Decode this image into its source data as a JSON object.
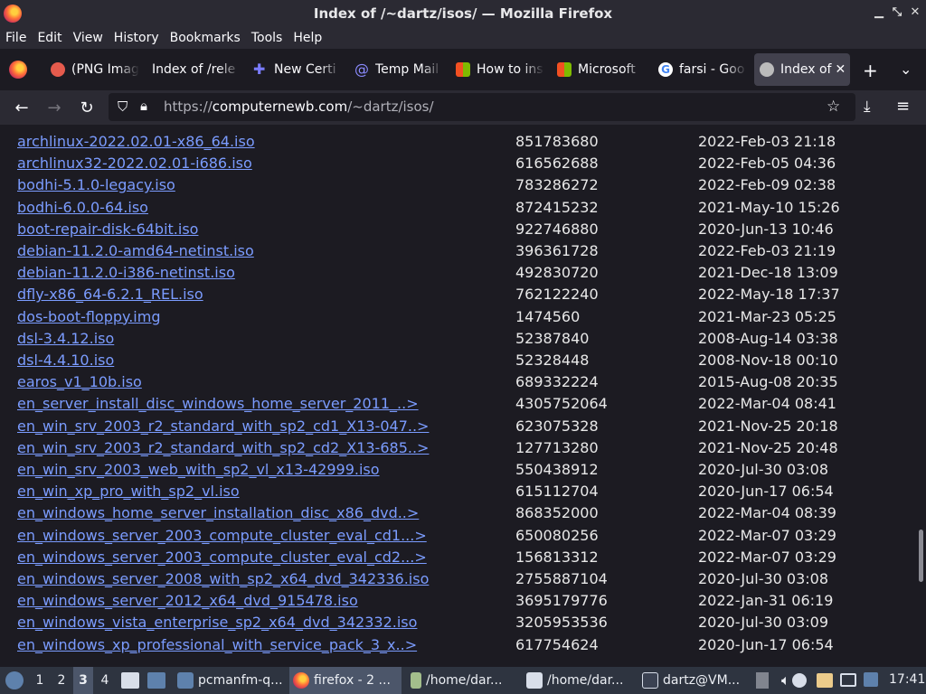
{
  "window": {
    "title": "Index of /~dartz/isos/ — Mozilla Firefox"
  },
  "menu": [
    "File",
    "Edit",
    "View",
    "History",
    "Bookmarks",
    "Tools",
    "Help"
  ],
  "tabs": [
    {
      "label": "(PNG Imag",
      "icon": "camera-icon",
      "color": "#e55b4d"
    },
    {
      "label": "Index of /rele",
      "icon": "none",
      "color": "#1c1b22"
    },
    {
      "label": "New Certi",
      "icon": "puzzle-icon",
      "color": "#7a7cff"
    },
    {
      "label": "Temp Mail",
      "icon": "at-icon",
      "color": "#7b7bff"
    },
    {
      "label": "How to ins",
      "icon": "microsoft-icon",
      "color": "#f25022"
    },
    {
      "label": "Microsoft",
      "icon": "microsoft-icon",
      "color": "#f25022"
    },
    {
      "label": "farsi - Goo",
      "icon": "google-icon",
      "color": "#ffffff"
    },
    {
      "label": "Index of",
      "icon": "gnu-icon",
      "color": "#cccccc"
    }
  ],
  "url": {
    "prefix": "https://",
    "host": "computernewb.com",
    "path": "/~dartz/isos/"
  },
  "files": [
    {
      "name": "archlinux-2022.02.01-x86_64.iso",
      "size": "851783680",
      "date": "2022-Feb-03 21:18"
    },
    {
      "name": "archlinux32-2022.02.01-i686.iso",
      "size": "616562688",
      "date": "2022-Feb-05 04:36"
    },
    {
      "name": "bodhi-5.1.0-legacy.iso",
      "size": "783286272",
      "date": "2022-Feb-09 02:38"
    },
    {
      "name": "bodhi-6.0.0-64.iso",
      "size": "872415232",
      "date": "2021-May-10 15:26"
    },
    {
      "name": "boot-repair-disk-64bit.iso",
      "size": "922746880",
      "date": "2020-Jun-13 10:46"
    },
    {
      "name": "debian-11.2.0-amd64-netinst.iso",
      "size": "396361728",
      "date": "2022-Feb-03 21:19"
    },
    {
      "name": "debian-11.2.0-i386-netinst.iso",
      "size": "492830720",
      "date": "2021-Dec-18 13:09"
    },
    {
      "name": "dfly-x86_64-6.2.1_REL.iso",
      "size": "762122240",
      "date": "2022-May-18 17:37"
    },
    {
      "name": "dos-boot-floppy.img",
      "size": "1474560",
      "date": "2021-Mar-23 05:25"
    },
    {
      "name": "dsl-3.4.12.iso",
      "size": "52387840",
      "date": "2008-Aug-14 03:38"
    },
    {
      "name": "dsl-4.4.10.iso",
      "size": "52328448",
      "date": "2008-Nov-18 00:10"
    },
    {
      "name": "earos_v1_10b.iso",
      "size": "689332224",
      "date": "2015-Aug-08 20:35"
    },
    {
      "name": "en_server_install_disc_windows_home_server_2011_..>",
      "size": "4305752064",
      "date": "2022-Mar-04 08:41"
    },
    {
      "name": "en_win_srv_2003_r2_standard_with_sp2_cd1_X13-047..>",
      "size": "623075328",
      "date": "2021-Nov-25 20:18"
    },
    {
      "name": "en_win_srv_2003_r2_standard_with_sp2_cd2_X13-685..>",
      "size": "127713280",
      "date": "2021-Nov-25 20:48"
    },
    {
      "name": "en_win_srv_2003_web_with_sp2_vl_x13-42999.iso",
      "size": "550438912",
      "date": "2020-Jul-30 03:08"
    },
    {
      "name": "en_win_xp_pro_with_sp2_vl.iso",
      "size": "615112704",
      "date": "2020-Jun-17 06:54"
    },
    {
      "name": "en_windows_home_server_installation_disc_x86_dvd..>",
      "size": "868352000",
      "date": "2022-Mar-04 08:39"
    },
    {
      "name": "en_windows_server_2003_compute_cluster_eval_cd1...>",
      "size": "650080256",
      "date": "2022-Mar-07 03:29"
    },
    {
      "name": "en_windows_server_2003_compute_cluster_eval_cd2...>",
      "size": "156813312",
      "date": "2022-Mar-07 03:29"
    },
    {
      "name": "en_windows_server_2008_with_sp2_x64_dvd_342336.iso",
      "size": "2755887104",
      "date": "2020-Jul-30 03:08"
    },
    {
      "name": "en_windows_server_2012_x64_dvd_915478.iso",
      "size": "3695179776",
      "date": "2022-Jan-31 06:19"
    },
    {
      "name": "en_windows_vista_enterprise_sp2_x64_dvd_342332.iso",
      "size": "3205953536",
      "date": "2020-Jul-30 03:09"
    },
    {
      "name": "en_windows_xp_professional_with_service_pack_3_x..>",
      "size": "617754624",
      "date": "2020-Jun-17 06:54"
    }
  ],
  "taskbar": {
    "workspaces": [
      "1",
      "2",
      "3",
      "4"
    ],
    "active_workspace": "3",
    "tasks": [
      {
        "label": "pcmanfm-q...",
        "icon": "folder-icon"
      },
      {
        "label": "firefox - 2 ...",
        "icon": "firefox-icon"
      },
      {
        "label": "/home/dar...",
        "icon": "text-editor-icon"
      },
      {
        "label": "/home/dar...",
        "icon": "pen-editor-icon"
      },
      {
        "label": "dartz@VM...",
        "icon": "terminal-icon"
      }
    ],
    "clock": "17:41"
  }
}
